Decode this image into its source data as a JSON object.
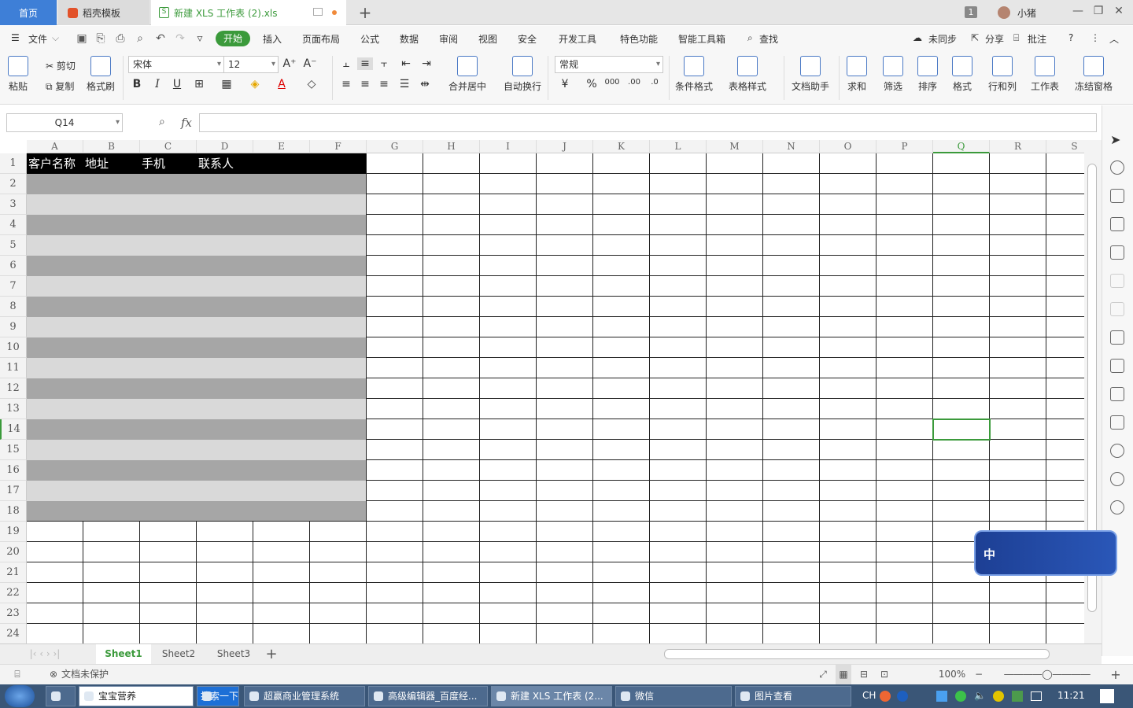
{
  "tabs": {
    "home": "首页",
    "template": "稻壳模板",
    "doc": "新建 XLS 工作表 (2).xls",
    "badge": "1",
    "user": "小猪"
  },
  "menu": {
    "file": "文件",
    "items": [
      "开始",
      "插入",
      "页面布局",
      "公式",
      "数据",
      "审阅",
      "视图",
      "安全",
      "开发工具",
      "特色功能",
      "智能工具箱",
      "查找"
    ],
    "right": [
      "未同步",
      "分享",
      "批注"
    ]
  },
  "ribbon": {
    "paste": "粘贴",
    "cut": "剪切",
    "copy": "复制",
    "format_painter": "格式刷",
    "font": "宋体",
    "size": "12",
    "merge": "合并居中",
    "wrap": "自动换行",
    "numfmt": "常规",
    "cond": "条件格式",
    "tablestyle": "表格样式",
    "docassist": "文档助手",
    "sum": "求和",
    "filter": "筛选",
    "sort": "排序",
    "format": "格式",
    "rowcol": "行和列",
    "sheet": "工作表",
    "freeze": "冻结窗格"
  },
  "formula": {
    "cell_ref": "Q14",
    "fx": "fx",
    "value": ""
  },
  "grid": {
    "columns": [
      "A",
      "B",
      "C",
      "D",
      "E",
      "F",
      "G",
      "H",
      "I",
      "J",
      "K",
      "L",
      "M",
      "N",
      "O",
      "P",
      "Q",
      "R",
      "S"
    ],
    "rows": [
      "1",
      "2",
      "3",
      "4",
      "5",
      "6",
      "7",
      "8",
      "9",
      "10",
      "11",
      "12",
      "13",
      "14",
      "15",
      "16",
      "17",
      "18",
      "19",
      "20",
      "21",
      "22",
      "23",
      "24"
    ],
    "header_cells": [
      "客户名称",
      "地址",
      "手机",
      "联系人"
    ],
    "selected_col": "Q",
    "selected_row": "14",
    "colors": {
      "header": "#000000",
      "band_dark": "#a6a6a6",
      "band_light": "#d9d9d9",
      "selection": "#3b9a3b"
    }
  },
  "sheets": [
    "Sheet1",
    "Sheet2",
    "Sheet3"
  ],
  "status": {
    "protect": "文档未保护",
    "zoom": "100%"
  },
  "ime": {
    "label": "中"
  },
  "taskbar": {
    "items": [
      "宝宝营养",
      "搜索一下",
      "超赢商业管理系统",
      "高级编辑器_百度经...",
      "新建 XLS 工作表 (2...",
      "微信",
      "图片查看"
    ],
    "lang": "CH",
    "time": "11:21"
  }
}
